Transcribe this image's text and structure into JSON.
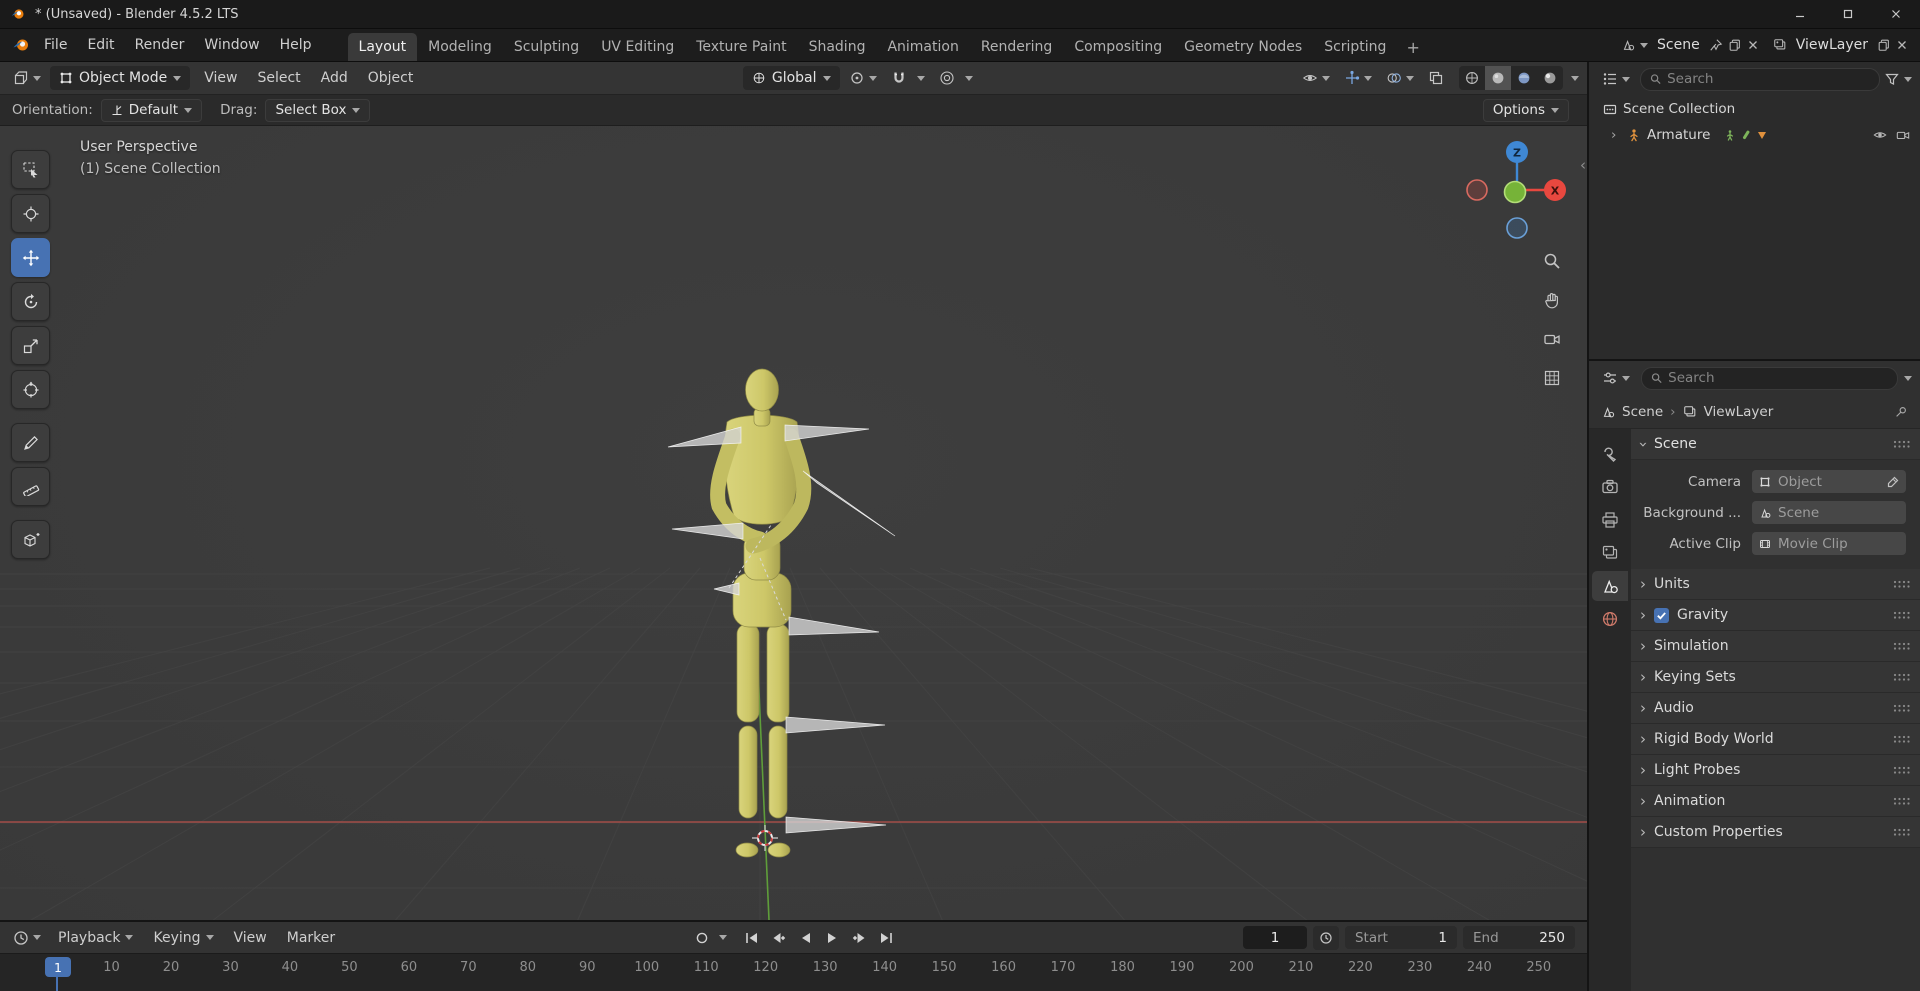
{
  "window": {
    "title": "* (Unsaved) - Blender 4.5.2 LTS"
  },
  "topbar": {
    "menus": [
      "File",
      "Edit",
      "Render",
      "Window",
      "Help"
    ],
    "workspaces": [
      "Layout",
      "Modeling",
      "Sculpting",
      "UV Editing",
      "Texture Paint",
      "Shading",
      "Animation",
      "Rendering",
      "Compositing",
      "Geometry Nodes",
      "Scripting"
    ],
    "active_workspace": "Layout",
    "add_workspace": "+",
    "scene_name": "Scene",
    "viewlayer_name": "ViewLayer"
  },
  "viewport_header": {
    "mode": "Object Mode",
    "menus": [
      "View",
      "Select",
      "Add",
      "Object"
    ],
    "orientation": "Global"
  },
  "tool_row": {
    "orientation_label": "Orientation:",
    "orientation_value": "Default",
    "drag_label": "Drag:",
    "drag_value": "Select Box",
    "options_label": "Options"
  },
  "viewport": {
    "perspective_label": "User Perspective",
    "collection_label": "(1) Scene Collection",
    "gizmo_x": "X",
    "gizmo_z": "Z"
  },
  "toolbar_tools": [
    "select-box",
    "cursor",
    "move",
    "rotate",
    "scale",
    "transform",
    "annotate",
    "measure",
    "add-cube"
  ],
  "toolbar_active_tool": "move",
  "outliner": {
    "search_placeholder": "Search",
    "collection": "Scene Collection",
    "armature": "Armature"
  },
  "properties": {
    "search_placeholder": "Search",
    "breadcrumb_scene": "Scene",
    "breadcrumb_separator": "›",
    "breadcrumb_viewlayer": "ViewLayer",
    "scene_panel": {
      "title": "Scene",
      "camera_label": "Camera",
      "camera_value": "Object",
      "background_label": "Background ...",
      "background_value": "Scene",
      "clip_label": "Active Clip",
      "clip_value": "Movie Clip"
    },
    "sections": [
      {
        "label": "Units",
        "checkbox": false
      },
      {
        "label": "Gravity",
        "checkbox": true
      },
      {
        "label": "Simulation",
        "checkbox": false
      },
      {
        "label": "Keying Sets",
        "checkbox": false
      },
      {
        "label": "Audio",
        "checkbox": false
      },
      {
        "label": "Rigid Body World",
        "checkbox": false
      },
      {
        "label": "Light Probes",
        "checkbox": false
      },
      {
        "label": "Animation",
        "checkbox": false
      },
      {
        "label": "Custom Properties",
        "checkbox": false
      }
    ]
  },
  "timeline": {
    "dropdown_menus": [
      "Playback",
      "Keying"
    ],
    "plain_menus": [
      "View",
      "Marker"
    ],
    "current_frame": "1",
    "start_label": "Start",
    "start_value": "1",
    "end_label": "End",
    "end_value": "250",
    "playhead_frame": "1",
    "ruler_ticks": [
      10,
      20,
      30,
      40,
      50,
      60,
      70,
      80,
      90,
      100,
      110,
      120,
      130,
      140,
      150,
      160,
      170,
      180,
      190,
      200,
      210,
      220,
      230,
      240,
      250
    ]
  },
  "colors": {
    "accent_blue": "#4772b3",
    "axis_x_red": "#e8483f",
    "axis_y_green": "#76b338",
    "axis_z_blue": "#3f88d4",
    "mannequin_olive": "#cdc768",
    "header_gray": "#343434",
    "viewport_gray": "#3b3b3b"
  }
}
